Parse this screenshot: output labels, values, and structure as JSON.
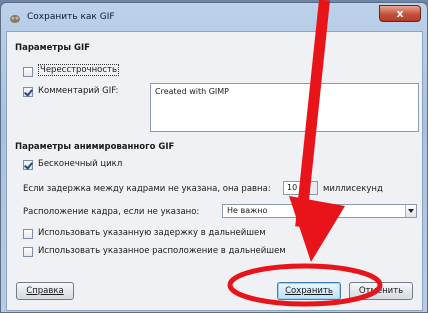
{
  "window": {
    "title": "Сохранить как GIF",
    "close_glyph": "x"
  },
  "gif_section": {
    "title": "Параметры GIF",
    "interlace": {
      "label": "Чересстрочность",
      "checked": false
    },
    "comment": {
      "label": "Комментарий GIF:",
      "checked": true,
      "value": "Created with GIMP"
    }
  },
  "anim_section": {
    "title": "Параметры анимированного GIF",
    "loop": {
      "label": "Бесконечный цикл",
      "checked": true
    },
    "delay": {
      "label": "Если задержка между кадрами не указана, она равна:",
      "value": "10",
      "unit": "миллисекунд"
    },
    "disposal": {
      "label": "Расположение кадра, если не указано:",
      "value": "Не важно"
    },
    "use_delay": {
      "label": "Использовать указанную задержку в дальнейшем",
      "checked": false
    },
    "use_disposal": {
      "label": "Использовать указанное расположение в дальнейшем",
      "checked": false
    }
  },
  "buttons": {
    "help": "Справка",
    "save": "Сохранить",
    "cancel": "Отменить"
  },
  "annotations": {
    "arrow_color": "#e8141a",
    "ellipse_color": "#e8141a"
  }
}
